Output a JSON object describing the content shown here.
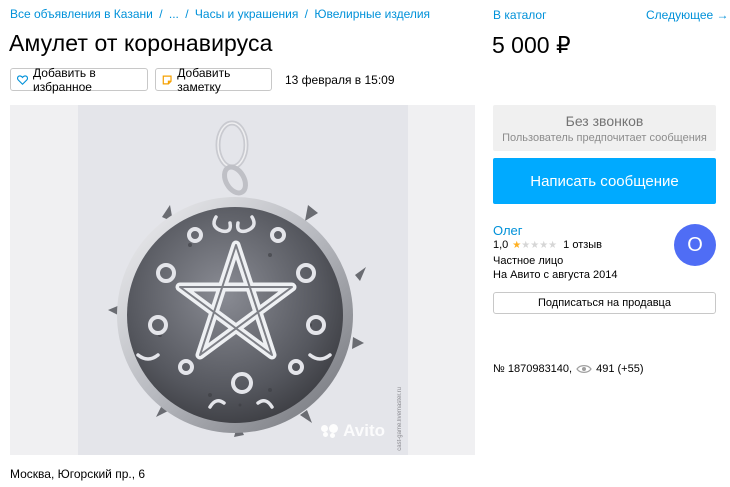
{
  "breadcrumbs": {
    "items": [
      "Все объявления в Казани",
      "...",
      "Часы и украшения",
      "Ювелирные изделия"
    ],
    "separator": "/"
  },
  "listing": {
    "title": "Амулет от коронавируса",
    "date": "13 февраля в 15:09",
    "price": "5 000 ₽",
    "address": "Москва, Югорский пр., 6",
    "id_text": "№ 1870983140,",
    "views_text": "491 (+55)"
  },
  "actions": {
    "favorite_label": "Добавить в избранное",
    "note_label": "Добавить заметку"
  },
  "nav": {
    "catalog_label": "В каталог",
    "next_label": "Следующее →"
  },
  "photo": {
    "watermark": "Avito",
    "side_mark": "cast-game.livemaster.ru"
  },
  "contact": {
    "no_calls_title": "Без звонков",
    "no_calls_subtitle": "Пользователь предпочитает сообщения",
    "write_button_label": "Написать сообщение"
  },
  "seller": {
    "name": "Олег",
    "rating_value": "1,0",
    "rating_stars": 1,
    "rating_max": 5,
    "reviews": "1 отзыв",
    "type": "Частное лицо",
    "since": "На Авито с августа 2014",
    "avatar_letter": "О",
    "avatar_color": "#4f6df5",
    "subscribe_label": "Подписаться на продавца"
  },
  "colors": {
    "link": "#0091d9",
    "primary_button": "#00aaff",
    "star_on": "#ffb021",
    "star_off": "#d6d6d6"
  },
  "icons": {
    "favorite": "heart-outline-icon",
    "note": "note-icon",
    "views": "eye-icon"
  }
}
